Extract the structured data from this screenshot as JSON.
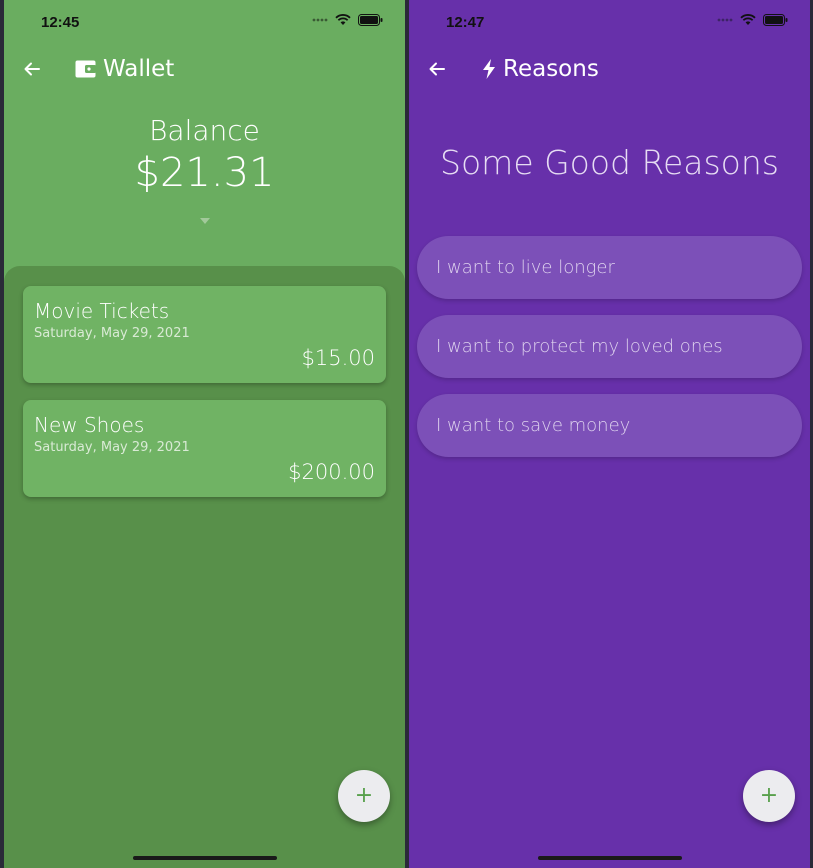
{
  "wallet_screen": {
    "status_time": "12:45",
    "title": "Wallet",
    "title_icon": "wallet-icon",
    "balance_label": "Balance",
    "balance_value": "$21.31",
    "transactions": [
      {
        "name": "Movie Tickets",
        "date": "Saturday, May 29, 2021",
        "amount": "$15.00"
      },
      {
        "name": "New Shoes",
        "date": "Saturday, May 29, 2021",
        "amount": "$200.00"
      }
    ],
    "fab_label": "+",
    "colors": {
      "background": "#6aad60",
      "sheet": "#58904a",
      "card": "#70b364",
      "fab_icon": "#58a04c"
    }
  },
  "reasons_screen": {
    "status_time": "12:47",
    "title": "Reasons",
    "title_icon": "lightning-icon",
    "heading": "Some Good Reasons",
    "reasons": [
      "I want to live longer",
      "I want to protect my loved ones",
      "I want to save money"
    ],
    "fab_label": "+",
    "colors": {
      "background": "#6730aa",
      "pill": "#7c50b8"
    }
  }
}
